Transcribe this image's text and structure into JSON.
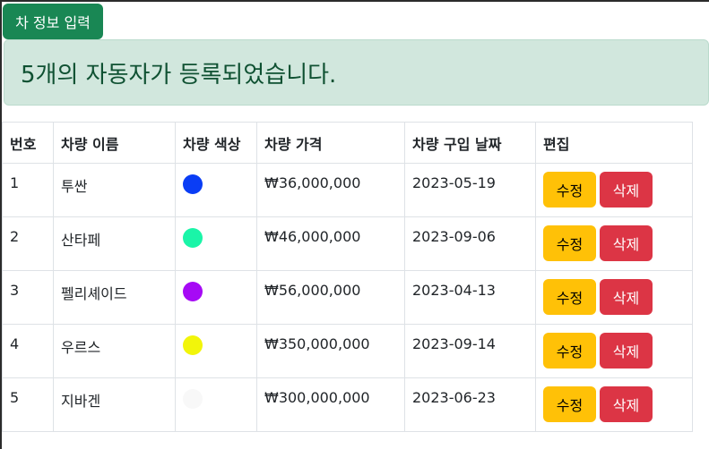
{
  "toolbar": {
    "add_label": "차 정보 입력"
  },
  "alert": {
    "message": "5개의 자동자가 등록되었습니다."
  },
  "table": {
    "headers": [
      "번호",
      "차량 이름",
      "차량 색상",
      "차량 가격",
      "차량 구입 날짜",
      "편집"
    ],
    "edit_label": "수정",
    "delete_label": "삭제",
    "rows": [
      {
        "no": "1",
        "name": "투싼",
        "color": "#0a3df5",
        "price": "₩36,000,000",
        "date": "2023-05-19"
      },
      {
        "no": "2",
        "name": "산타페",
        "color": "#1af5a8",
        "price": "₩46,000,000",
        "date": "2023-09-06"
      },
      {
        "no": "3",
        "name": "펠리셰이드",
        "color": "#a60af5",
        "price": "₩56,000,000",
        "date": "2023-04-13"
      },
      {
        "no": "4",
        "name": "우르스",
        "color": "#f2f50a",
        "price": "₩350,000,000",
        "date": "2023-09-14"
      },
      {
        "no": "5",
        "name": "지바겐",
        "color": "#f8f8f8",
        "price": "₩300,000,000",
        "date": "2023-06-23"
      }
    ]
  }
}
